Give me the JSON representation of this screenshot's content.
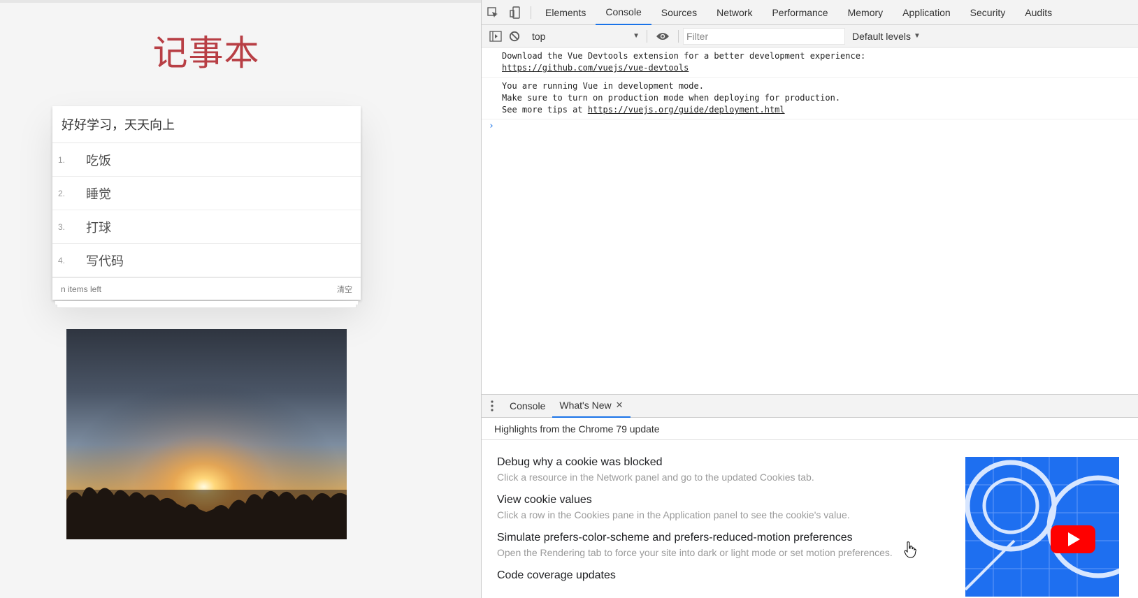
{
  "page": {
    "title": "记事本",
    "input_value": "好好学习，天天向上",
    "todos": [
      {
        "index": "1.",
        "text": "吃饭"
      },
      {
        "index": "2.",
        "text": "睡觉"
      },
      {
        "index": "3.",
        "text": "打球"
      },
      {
        "index": "4.",
        "text": "写代码"
      }
    ],
    "footer_left": "n items left",
    "clear_label": "清空"
  },
  "devtools": {
    "tabs": [
      "Elements",
      "Console",
      "Sources",
      "Network",
      "Performance",
      "Memory",
      "Application",
      "Security",
      "Audits"
    ],
    "active_tab": "Console",
    "context": "top",
    "filter_placeholder": "Filter",
    "levels_label": "Default levels",
    "messages": [
      {
        "lines": [
          "Download the Vue Devtools extension for a better development experience:"
        ],
        "link": "https://github.com/vuejs/vue-devtools",
        "link_prefix": ""
      },
      {
        "lines": [
          "You are running Vue in development mode.",
          "Make sure to turn on production mode when deploying for production."
        ],
        "link": "https://vuejs.org/guide/deployment.html",
        "link_prefix": "See more tips at "
      }
    ],
    "prompt": "›",
    "drawer_tabs": [
      "Console",
      "What's New"
    ],
    "drawer_active": "What's New",
    "highlights": "Highlights from the Chrome 79 update",
    "features": [
      {
        "title": "Debug why a cookie was blocked",
        "desc": "Click a resource in the Network panel and go to the updated Cookies tab."
      },
      {
        "title": "View cookie values",
        "desc": "Click a row in the Cookies pane in the Application panel to see the cookie's value."
      },
      {
        "title": "Simulate prefers-color-scheme and prefers-reduced-motion preferences",
        "desc": "Open the Rendering tab to force your site into dark or light mode or set motion preferences."
      },
      {
        "title": "Code coverage updates",
        "desc": ""
      }
    ],
    "colors": {
      "accent": "#1a73e8",
      "title_red": "#b83f45",
      "youtube_red": "#ff0000",
      "thumb_blue": "#1e6ff0"
    }
  }
}
